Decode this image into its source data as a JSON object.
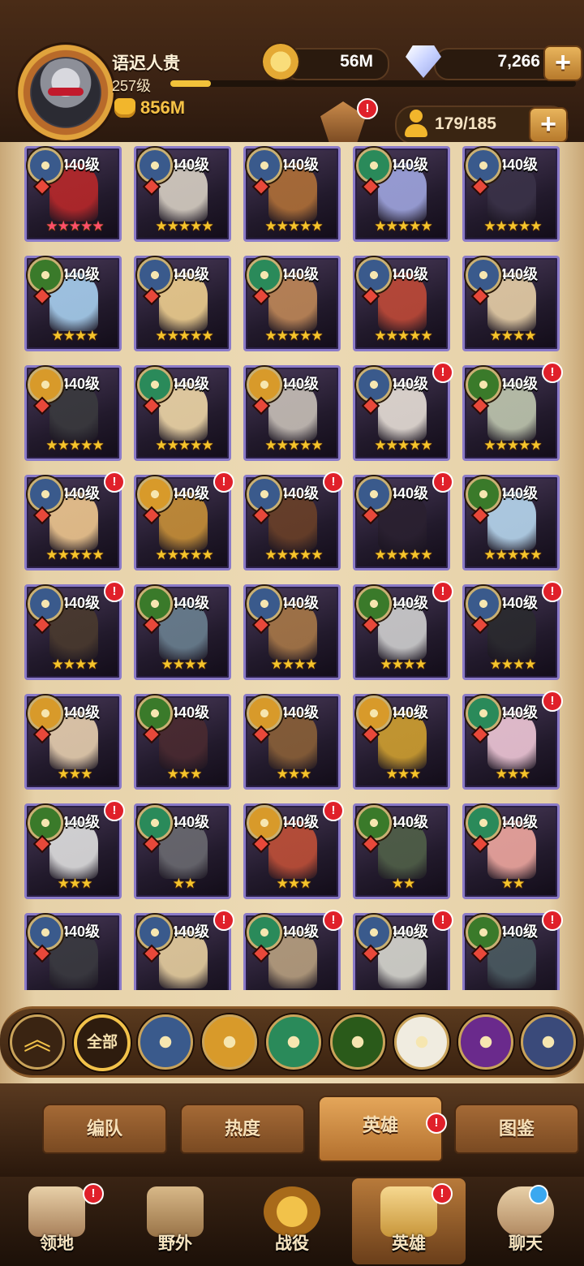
{
  "player": {
    "name": "语迟人贵",
    "level": "257级",
    "xp_progress": 0.1,
    "power": "856M"
  },
  "resources": {
    "gold": "56M",
    "gems": "7,266",
    "roster": "179/185",
    "plus": "+"
  },
  "alert_mark": "!",
  "heroes": [
    {
      "level": "440级",
      "stars": "★★★★★",
      "star_color": "pink",
      "faction": "lightbearer",
      "alert": false,
      "portrait": "#b8282a"
    },
    {
      "level": "440级",
      "stars": "★★★★★",
      "star_color": "gold",
      "faction": "lightbearer",
      "alert": false,
      "portrait": "#d8d0c4"
    },
    {
      "level": "440级",
      "stars": "★★★★★",
      "star_color": "gold",
      "faction": "lightbearer",
      "alert": false,
      "portrait": "#b07038"
    },
    {
      "level": "440级",
      "stars": "★★★★★",
      "star_color": "gold",
      "faction": "wilder",
      "alert": false,
      "portrait": "#a0a6e0"
    },
    {
      "level": "440级",
      "stars": "★★★★★",
      "star_color": "gold",
      "faction": "lightbearer",
      "alert": false,
      "portrait": "#3a3248"
    },
    {
      "level": "440级",
      "stars": "★★★★",
      "star_color": "gold",
      "faction": "graveborn",
      "alert": false,
      "portrait": "#a8d0f0"
    },
    {
      "level": "440级",
      "stars": "★★★★★",
      "star_color": "gold",
      "faction": "lightbearer",
      "alert": false,
      "portrait": "#f0d090"
    },
    {
      "level": "440级",
      "stars": "★★★★★",
      "star_color": "gold",
      "faction": "wilder",
      "alert": false,
      "portrait": "#c08858"
    },
    {
      "level": "440级",
      "stars": "★★★★★",
      "star_color": "gold",
      "faction": "lightbearer",
      "alert": false,
      "portrait": "#c04a38"
    },
    {
      "level": "440级",
      "stars": "★★★★",
      "star_color": "gold",
      "faction": "lightbearer",
      "alert": false,
      "portrait": "#e8d0a8"
    },
    {
      "level": "440级",
      "stars": "★★★★★",
      "star_color": "gold",
      "faction": "mauler",
      "alert": false,
      "portrait": "#3a3a3e"
    },
    {
      "level": "440级",
      "stars": "★★★★★",
      "star_color": "gold",
      "faction": "wilder",
      "alert": false,
      "portrait": "#f0d8a8"
    },
    {
      "level": "440级",
      "stars": "★★★★★",
      "star_color": "gold",
      "faction": "mauler",
      "alert": false,
      "portrait": "#c8c0b8"
    },
    {
      "level": "440级",
      "stars": "★★★★★",
      "star_color": "gold",
      "faction": "lightbearer",
      "alert": true,
      "portrait": "#e8e0d8"
    },
    {
      "level": "440级",
      "stars": "★★★★★",
      "star_color": "gold",
      "faction": "graveborn",
      "alert": true,
      "portrait": "#c0c8b0"
    },
    {
      "level": "440级",
      "stars": "★★★★★",
      "star_color": "gold",
      "faction": "lightbearer",
      "alert": true,
      "portrait": "#f0c890"
    },
    {
      "level": "440级",
      "stars": "★★★★★",
      "star_color": "gold",
      "faction": "mauler",
      "alert": true,
      "portrait": "#c89038"
    },
    {
      "level": "440级",
      "stars": "★★★★★",
      "star_color": "gold",
      "faction": "lightbearer",
      "alert": true,
      "portrait": "#6a4028"
    },
    {
      "level": "440级",
      "stars": "★★★★★",
      "star_color": "gold",
      "faction": "lightbearer",
      "alert": true,
      "portrait": "#2a2030"
    },
    {
      "level": "440级",
      "stars": "★★★★★",
      "star_color": "gold",
      "faction": "graveborn",
      "alert": false,
      "portrait": "#b8d8f0"
    },
    {
      "level": "440级",
      "stars": "★★★★",
      "star_color": "gold",
      "faction": "lightbearer",
      "alert": true,
      "portrait": "#4a3a2e"
    },
    {
      "level": "440级",
      "stars": "★★★★",
      "star_color": "gold",
      "faction": "graveborn",
      "alert": false,
      "portrait": "#6a8090"
    },
    {
      "level": "440级",
      "stars": "★★★★",
      "star_color": "gold",
      "faction": "lightbearer",
      "alert": false,
      "portrait": "#a87848"
    },
    {
      "level": "440级",
      "stars": "★★★★",
      "star_color": "gold",
      "faction": "graveborn",
      "alert": true,
      "portrait": "#d0d0d0"
    },
    {
      "level": "440级",
      "stars": "★★★★",
      "star_color": "gold",
      "faction": "lightbearer",
      "alert": true,
      "portrait": "#2a2a2e"
    },
    {
      "level": "440级",
      "stars": "★★★",
      "star_color": "gold",
      "faction": "mauler",
      "alert": false,
      "portrait": "#e8d0b0"
    },
    {
      "level": "440级",
      "stars": "★★★",
      "star_color": "gold",
      "faction": "graveborn",
      "alert": false,
      "portrait": "#4a2a30"
    },
    {
      "level": "440级",
      "stars": "★★★",
      "star_color": "gold",
      "faction": "mauler",
      "alert": false,
      "portrait": "#8a6038"
    },
    {
      "level": "440级",
      "stars": "★★★",
      "star_color": "gold",
      "faction": "mauler",
      "alert": false,
      "portrait": "#d0a030"
    },
    {
      "level": "440级",
      "stars": "★★★",
      "star_color": "gold",
      "faction": "wilder",
      "alert": true,
      "portrait": "#f0c8d8"
    },
    {
      "level": "440级",
      "stars": "★★★",
      "star_color": "gold",
      "faction": "graveborn",
      "alert": true,
      "portrait": "#e0e0e0"
    },
    {
      "level": "440级",
      "stars": "★★",
      "star_color": "gold",
      "faction": "wilder",
      "alert": false,
      "portrait": "#6a6a70"
    },
    {
      "level": "440级",
      "stars": "★★★",
      "star_color": "gold",
      "faction": "mauler",
      "alert": true,
      "portrait": "#c05038"
    },
    {
      "level": "440级",
      "stars": "★★",
      "star_color": "gold",
      "faction": "graveborn",
      "alert": false,
      "portrait": "#506048"
    },
    {
      "level": "440级",
      "stars": "★★",
      "star_color": "gold",
      "faction": "wilder",
      "alert": false,
      "portrait": "#f0a8a0"
    },
    {
      "level": "440级",
      "stars": "",
      "star_color": "gold",
      "faction": "lightbearer",
      "alert": false,
      "portrait": "#3a3a40"
    },
    {
      "level": "440级",
      "stars": "",
      "star_color": "gold",
      "faction": "lightbearer",
      "alert": true,
      "portrait": "#e8d0a0"
    },
    {
      "level": "440级",
      "stars": "",
      "star_color": "gold",
      "faction": "wilder",
      "alert": true,
      "portrait": "#b8a080"
    },
    {
      "level": "440级",
      "stars": "",
      "star_color": "gold",
      "faction": "lightbearer",
      "alert": true,
      "portrait": "#d8d8d0"
    },
    {
      "level": "440级",
      "stars": "",
      "star_color": "gold",
      "faction": "graveborn",
      "alert": true,
      "portrait": "#4a5a60"
    }
  ],
  "faction_colors": {
    "lightbearer": "#3a5a8c",
    "wilder": "#2a8a5a",
    "mauler": "#d89a2a",
    "graveborn": "#3a7a2a"
  },
  "faction_filters": [
    {
      "name": "collapse-up",
      "label": "︽"
    },
    {
      "name": "all",
      "label": "全部"
    },
    {
      "name": "lightbearer",
      "color": "#3a5a8c"
    },
    {
      "name": "mauler",
      "color": "#d89a2a"
    },
    {
      "name": "wilder",
      "color": "#2a8a5a"
    },
    {
      "name": "graveborn",
      "color": "#2a5a1a"
    },
    {
      "name": "celestial",
      "color": "#f0ece0"
    },
    {
      "name": "hypogean",
      "color": "#6a2a8c"
    },
    {
      "name": "dimensional",
      "color": "#3a4a7a"
    }
  ],
  "tabs": {
    "formation": "编队",
    "popularity": "热度",
    "heroes": "英雄",
    "codex": "图鉴"
  },
  "nav": {
    "territory": "领地",
    "wilds": "野外",
    "campaign": "战役",
    "heroes": "英雄",
    "chat": "聊天"
  }
}
